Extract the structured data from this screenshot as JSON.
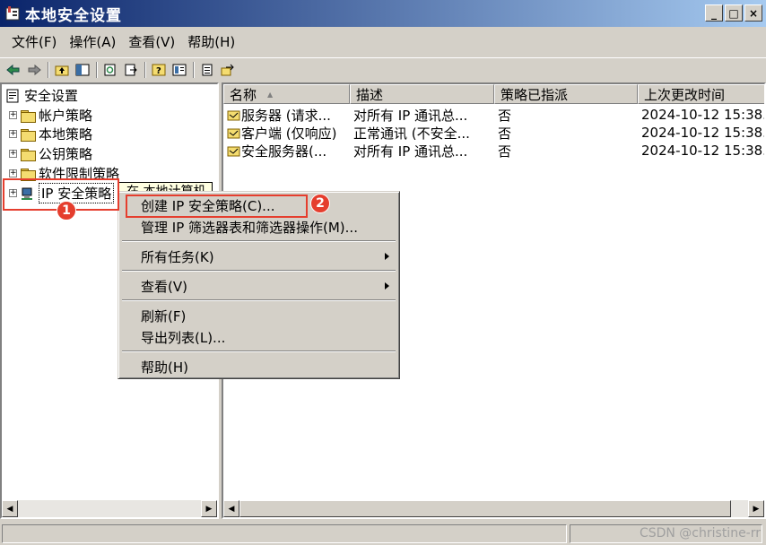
{
  "window": {
    "title": "本地安全设置",
    "buttons": {
      "minimize": "_",
      "maximize": "□",
      "close": "×"
    }
  },
  "menubar": [
    {
      "label": "文件(F)"
    },
    {
      "label": "操作(A)"
    },
    {
      "label": "查看(V)"
    },
    {
      "label": "帮助(H)"
    }
  ],
  "tree": {
    "root": "安全设置",
    "items": [
      {
        "label": "帐户策略",
        "expander": "+"
      },
      {
        "label": "本地策略",
        "expander": "+"
      },
      {
        "label": "公钥策略",
        "expander": "+"
      },
      {
        "label": "软件限制策略",
        "expander": "+"
      },
      {
        "label": "IP 安全策略",
        "expander": "+"
      }
    ],
    "tooltip": "在 本地计算机"
  },
  "list": {
    "columns": [
      "名称",
      "描述",
      "策略已指派",
      "上次更改时间"
    ],
    "sort_indicator": "▲",
    "rows": [
      {
        "name": "服务器 (请求...",
        "desc": "对所有 IP 通讯总...",
        "assigned": "否",
        "modified": "2024-10-12 15:38..."
      },
      {
        "name": "客户端 (仅响应)",
        "desc": "正常通讯 (不安全...",
        "assigned": "否",
        "modified": "2024-10-12 15:38..."
      },
      {
        "name": "安全服务器(...",
        "desc": "对所有 IP 通讯总...",
        "assigned": "否",
        "modified": "2024-10-12 15:38..."
      }
    ]
  },
  "context_menu": {
    "items": [
      {
        "label": "创建 IP 安全策略(C)..."
      },
      {
        "label": "管理 IP 筛选器表和筛选器操作(M)..."
      },
      {
        "label": "所有任务(K)"
      },
      {
        "label": "查看(V)"
      },
      {
        "label": "刷新(F)"
      },
      {
        "label": "导出列表(L)..."
      },
      {
        "label": "帮助(H)"
      }
    ]
  },
  "annotations": {
    "badge1": "1",
    "badge2": "2"
  },
  "watermark": "CSDN @christine-rr",
  "colors": {
    "titlebar_start": "#0a246a",
    "titlebar_end": "#a6caf0",
    "highlight": "#e53e2e",
    "tooltip_bg": "#ffffe1"
  },
  "icons": [
    "app-icon",
    "back-icon",
    "forward-icon",
    "up-folder-icon",
    "show-tree-icon",
    "refresh-icon",
    "export-icon",
    "help-icon",
    "properties-icon",
    "policy-icon",
    "ipsec-icon"
  ]
}
